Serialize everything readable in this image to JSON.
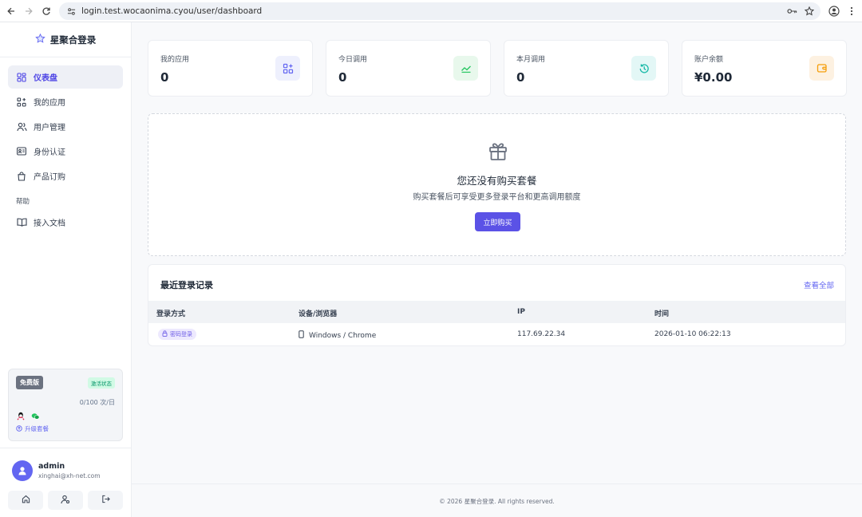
{
  "browser": {
    "url": "login.test.wocaonima.cyou/user/dashboard"
  },
  "sidebar": {
    "brand": "星聚合登录",
    "items": [
      {
        "label": "仪表盘",
        "icon": "dashboard-icon",
        "active": true
      },
      {
        "label": "我的应用",
        "icon": "apps-icon",
        "active": false
      },
      {
        "label": "用户管理",
        "icon": "users-icon",
        "active": false
      },
      {
        "label": "身份认证",
        "icon": "id-card-icon",
        "active": false
      },
      {
        "label": "产品订购",
        "icon": "shopping-bag-icon",
        "active": false
      }
    ],
    "help_group": "帮助",
    "help_items": [
      {
        "label": "接入文档",
        "icon": "book-icon"
      }
    ],
    "plan": {
      "name": "免费版",
      "status": "激活状态",
      "usage": "0/100 次/日",
      "upgrade": "升级套餐"
    },
    "user": {
      "name": "admin",
      "email": "xinghai@xh-net.com"
    }
  },
  "stats": [
    {
      "label": "我的应用",
      "value": "0",
      "icon": "apps-add-icon",
      "color": "#6366f1",
      "bg": "#eef0fd"
    },
    {
      "label": "今日调用",
      "value": "0",
      "icon": "trend-line-icon",
      "color": "#22c55e",
      "bg": "#e8f8ec"
    },
    {
      "label": "本月调用",
      "value": "0",
      "icon": "history-icon",
      "color": "#14b8a6",
      "bg": "#e3f7f6"
    },
    {
      "label": "账户余额",
      "value": "¥0.00",
      "icon": "wallet-icon",
      "color": "#f59e0b",
      "bg": "#fdf1e1"
    }
  ],
  "promo": {
    "title": "您还没有购买套餐",
    "subtitle": "购买套餐后可享受更多登录平台和更高调用额度",
    "button": "立即购买"
  },
  "recent_logins": {
    "title": "最近登录记录",
    "view_all": "查看全部",
    "columns": [
      "登录方式",
      "设备/浏览器",
      "IP",
      "时间"
    ],
    "rows": [
      {
        "method": "密码登录",
        "device": "Windows / Chrome",
        "ip": "117.69.22.34",
        "time": "2026-01-10 06:22:13"
      }
    ]
  },
  "footer": {
    "text": "© 2026 星聚合登录. All rights reserved."
  },
  "colors": {
    "accent": "#6366f1",
    "primary_button": "#5b52e6",
    "success": "#059669"
  }
}
